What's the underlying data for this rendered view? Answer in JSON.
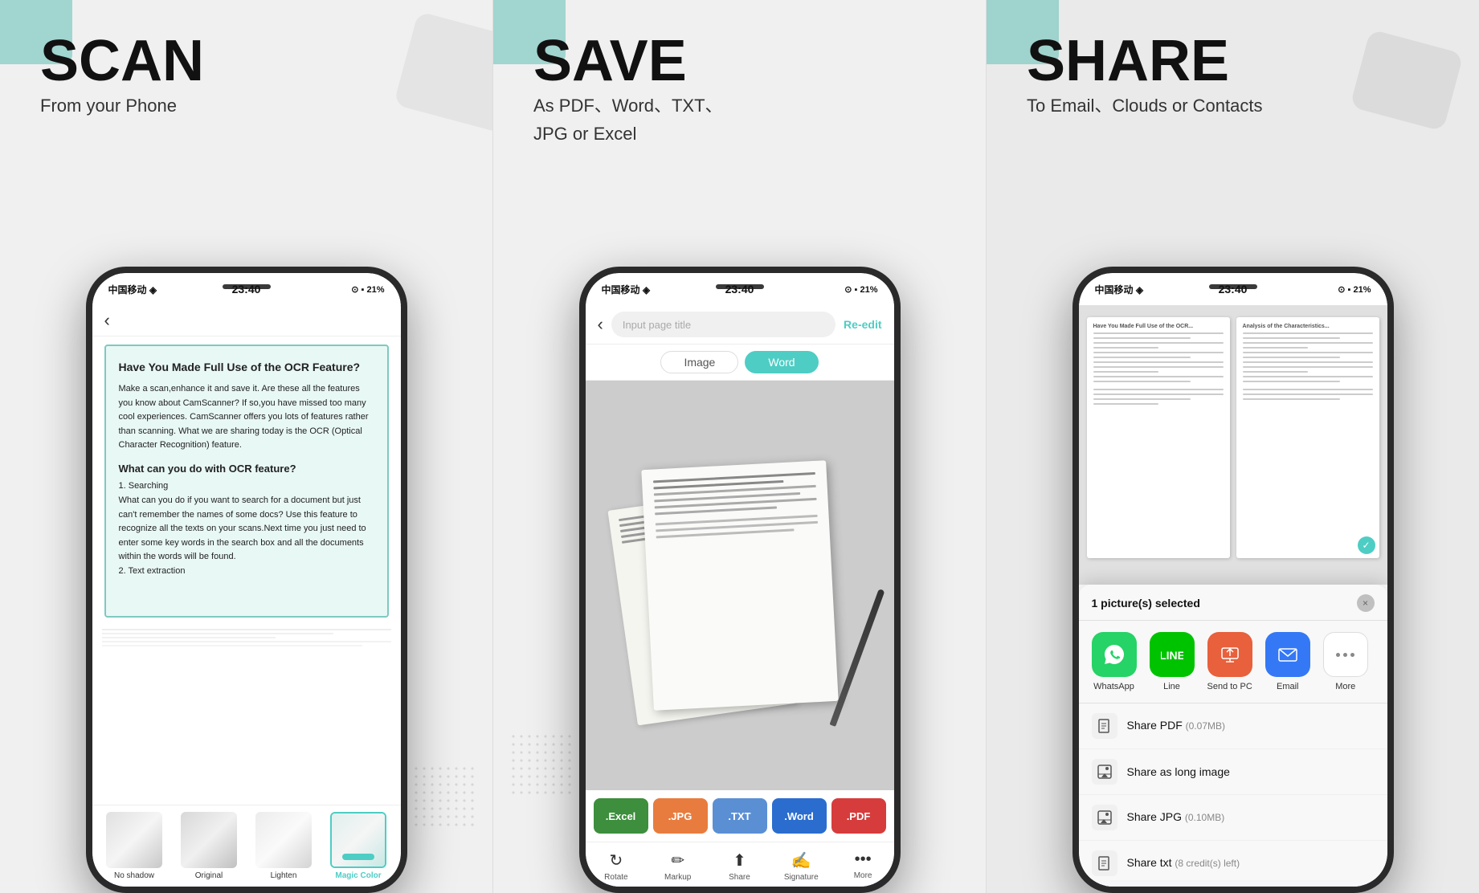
{
  "scan": {
    "heading": "SCAN",
    "subheading": "From your Phone",
    "phone": {
      "status_left": "中国移动 奥",
      "time": "23:40",
      "battery": "21%",
      "doc_title": "Have You Made Full Use of the OCR Feature?",
      "doc_body1": "Make a scan,enhance it and save it. Are these all the features you know about CamScanner? If so,you have missed too many cool experiences. CamScanner offers you lots of features rather than scanning. What we are sharing today is the OCR (Optical Character Recognition) feature.",
      "doc_section1": "What can you do with OCR feature?",
      "doc_body2": "1. Searching",
      "doc_body3": "What can you do if you want to search for a document but just can't remember the names of some docs? Use this feature to recognize all the texts on your scans.Next time you just need to enter some key words in the search box and all the documents within the words will be found.",
      "doc_body4": "2. Text extraction",
      "filter_labels": [
        "No shadow",
        "Original",
        "Lighten",
        "Magic Color"
      ]
    }
  },
  "save": {
    "heading": "SAVE",
    "subheading1": "As PDF、Word、TXT、",
    "subheading2": "JPG or Excel",
    "phone": {
      "time": "23:40",
      "title_placeholder": "Input page title",
      "reedit": "Re-edit",
      "tab_image": "Image",
      "tab_word": "Word",
      "format_labels": [
        ".Excel",
        ".JPG",
        ".TXT",
        ".Word",
        ".PDF"
      ],
      "toolbar_items": [
        "Rotate",
        "Markup",
        "Share",
        "Signature",
        "More"
      ]
    }
  },
  "share": {
    "heading": "SHARE",
    "subheading": "To Email、Clouds or Contacts",
    "phone": {
      "time": "23:40",
      "selected_text": "1 picture(s) selected",
      "close": "×",
      "apps": [
        {
          "label": "WhatsApp",
          "icon": "💬",
          "color": "#25d366"
        },
        {
          "label": "Line",
          "icon": "💬",
          "color": "#00c300"
        },
        {
          "label": "Send to PC",
          "icon": "🖥",
          "color": "#e8603c"
        },
        {
          "label": "Email",
          "icon": "✉",
          "color": "#3478f6"
        },
        {
          "label": "More",
          "icon": "•••",
          "color": "#fff"
        }
      ],
      "options": [
        {
          "text": "Share PDF",
          "sub": "0.07MB",
          "icon": "📄"
        },
        {
          "text": "Share as long image",
          "sub": "",
          "icon": "🖼"
        },
        {
          "text": "Share JPG",
          "sub": "0.10MB",
          "icon": "🖼"
        },
        {
          "text": "Share txt",
          "sub": "8 credit(s) left",
          "icon": "📝"
        }
      ]
    }
  }
}
